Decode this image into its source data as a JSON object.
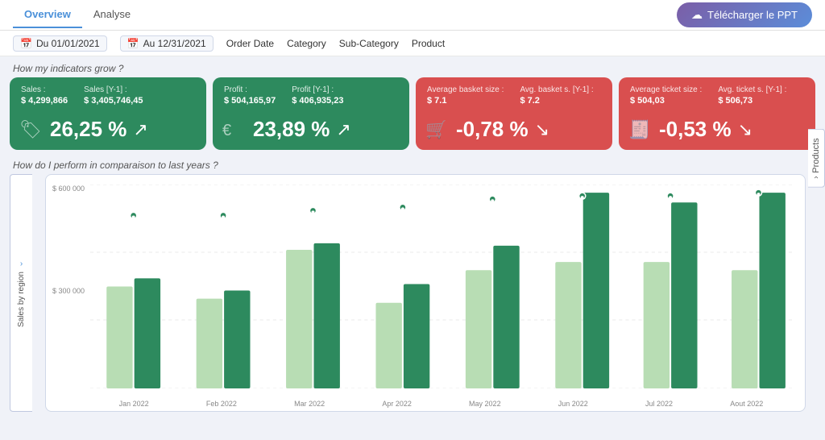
{
  "header": {
    "tabs": [
      {
        "label": "Overview",
        "active": true
      },
      {
        "label": "Analyse",
        "active": false
      }
    ],
    "download_button": "Télécharger le PPT"
  },
  "filters": {
    "date_from": "Du 01/01/2021",
    "date_to": "Au 12/31/2021",
    "order_date": "Order Date",
    "category": "Category",
    "sub_category": "Sub-Category",
    "product": "Product"
  },
  "section1_title": "How my indicators grow ?",
  "section2_title": "How do I perform in comparaison to last years ?",
  "kpi_cards": [
    {
      "color": "green",
      "labels": [
        "Sales :",
        "Sales [Y-1] :"
      ],
      "values": [
        "$ 4,299,866",
        "$ 3,405,746,45"
      ],
      "percent": "26,25 %",
      "arrow": "↗",
      "icon": "🏷"
    },
    {
      "color": "green",
      "labels": [
        "Profit :",
        "Profit [Y-1] :"
      ],
      "values": [
        "$ 504,165,97",
        "$ 406,935,23"
      ],
      "percent": "23,89 %",
      "arrow": "↗",
      "icon": "€"
    },
    {
      "color": "red",
      "labels": [
        "Average basket size :",
        "Avg. basket s. [Y-1] :"
      ],
      "values": [
        "$ 7.1",
        "$ 7.2"
      ],
      "percent": "-0,78 %",
      "arrow": "↘",
      "icon": "🛒"
    },
    {
      "color": "red",
      "labels": [
        "Average ticket size :",
        "Avg. ticket s. [Y-1] :"
      ],
      "values": [
        "$ 504,03",
        "$ 506,73"
      ],
      "percent": "-0,53 %",
      "arrow": "↘",
      "icon": "🧾"
    }
  ],
  "products_tab": "Products",
  "sales_region_tab": "Sales by region",
  "chart": {
    "y_labels": [
      "$ 600 000",
      "$ 300 000",
      ""
    ],
    "x_labels": [
      "Jan 2022",
      "Feb 2022",
      "Mar 2022",
      "Apr 2022",
      "May 2022",
      "Jun 2022",
      "Jul 2022",
      "Aout 2022"
    ],
    "bar_groups": [
      {
        "light": 50,
        "dark": 55
      },
      {
        "light": 42,
        "dark": 47
      },
      {
        "light": 65,
        "dark": 67
      },
      {
        "light": 38,
        "dark": 53
      },
      {
        "light": 58,
        "dark": 67
      },
      {
        "light": 60,
        "dark": 100
      },
      {
        "light": 60,
        "dark": 92
      },
      {
        "light": 55,
        "dark": 100
      }
    ],
    "dot_heights": [
      28,
      28,
      33,
      38,
      45,
      50,
      50,
      55
    ]
  }
}
